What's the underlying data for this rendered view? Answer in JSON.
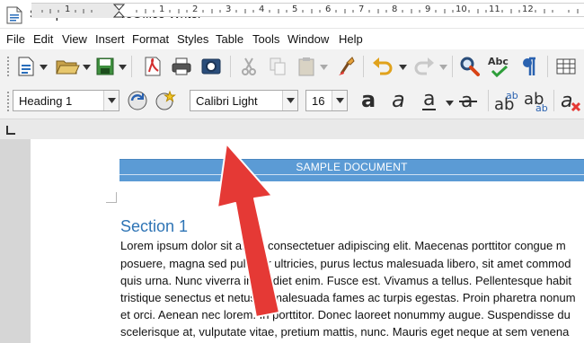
{
  "window": {
    "title": "Sample.odt - LibreOffice Writer"
  },
  "menu": [
    "File",
    "Edit",
    "View",
    "Insert",
    "Format",
    "Styles",
    "Table",
    "Tools",
    "Window",
    "Help"
  ],
  "toolbar1": {
    "icons": [
      "new-document-icon",
      "open-folder-icon",
      "save-icon",
      "export-pdf-icon",
      "print-icon",
      "print-preview-icon",
      "cut-icon",
      "copy-icon",
      "paste-icon",
      "clone-formatting-icon",
      "undo-icon",
      "redo-icon",
      "find-replace-icon",
      "spelling-icon",
      "formatting-marks-icon",
      "insert-table-icon"
    ]
  },
  "toolbar2": {
    "paragraph_style": "Heading 1",
    "font_name": "Calibri Light",
    "font_size": "16",
    "icons": [
      "update-style-icon",
      "new-style-icon",
      "bold-icon",
      "italic-icon",
      "underline-icon",
      "strikethrough-icon",
      "superscript-icon",
      "subscript-icon",
      "clear-formatting-icon"
    ],
    "format_glyphs": {
      "bold": "a",
      "italic": "a",
      "underline": "a",
      "strike": "a",
      "superscript": "ab",
      "subscript": "ab",
      "clear": "a"
    }
  },
  "ruler": {
    "numbers": [
      "1",
      "1",
      "2",
      "3",
      "4",
      "5",
      "6",
      "7",
      "8",
      "9",
      "10",
      "11",
      "12"
    ]
  },
  "document": {
    "header": "SAMPLE DOCUMENT",
    "section_title": "Section 1",
    "lines": [
      "Lorem ipsum dolor sit amet, consectetuer adipiscing elit. Maecenas porttitor congue m",
      "posuere, magna sed pulvinar ultricies, purus lectus malesuada libero, sit amet commod",
      "quis urna. Nunc viverra imperdiet enim. Fusce est. Vivamus a tellus. Pellentesque habit",
      "tristique senectus et netus et malesuada fames ac turpis egestas. Proin pharetra nonum",
      "et orci. Aenean nec lorem. In porttitor. Donec laoreet nonummy augue. Suspendisse du",
      "scelerisque at, vulputate vitae, pretium mattis, nunc. Mauris eget neque at sem venena"
    ]
  },
  "colors": {
    "accent": "#5b9bd5",
    "heading": "#2e74b5",
    "arrow": "#e53935"
  }
}
